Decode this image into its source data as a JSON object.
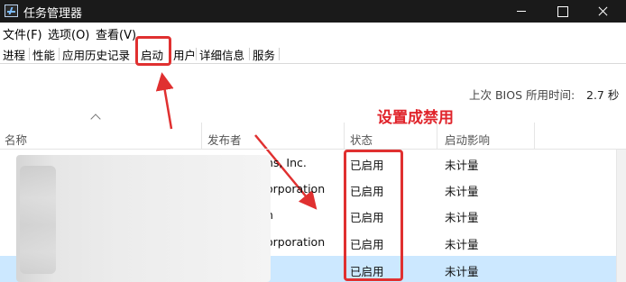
{
  "window": {
    "title": "任务管理器",
    "minimize_icon": "minimize-icon",
    "maximize_icon": "maximize-icon",
    "close_icon": "close-icon"
  },
  "menu": [
    {
      "label": "文件(F)"
    },
    {
      "label": "选项(O)"
    },
    {
      "label": "查看(V)"
    }
  ],
  "tabs": [
    {
      "label": "进程"
    },
    {
      "label": "性能"
    },
    {
      "label": "应用历史记录"
    },
    {
      "label": "启动",
      "active": true
    },
    {
      "label": "用户"
    },
    {
      "label": "详细信息"
    },
    {
      "label": "服务"
    }
  ],
  "bios": {
    "label": "上次 BIOS 所用时间:",
    "value": "2.7 秒"
  },
  "annotation": {
    "text": "设置成禁用",
    "color": "#e0242b"
  },
  "table": {
    "columns": [
      "名称",
      "发布者",
      "状态",
      "启动影响"
    ],
    "rows": [
      {
        "publisher": "ns, Inc.",
        "status": "已启用",
        "impact": "未计量"
      },
      {
        "publisher": "orporation",
        "status": "已启用",
        "impact": "未计量"
      },
      {
        "publisher": "n",
        "status": "已启用",
        "impact": "未计量"
      },
      {
        "publisher": "orporation",
        "status": "已启用",
        "impact": "未计量"
      },
      {
        "publisher": "",
        "status": "已启用",
        "impact": "未计量",
        "selected": true
      }
    ]
  },
  "colors": {
    "highlight": "#e03030",
    "selected_row": "#cce8ff",
    "titlebar": "#1a1a1a"
  }
}
